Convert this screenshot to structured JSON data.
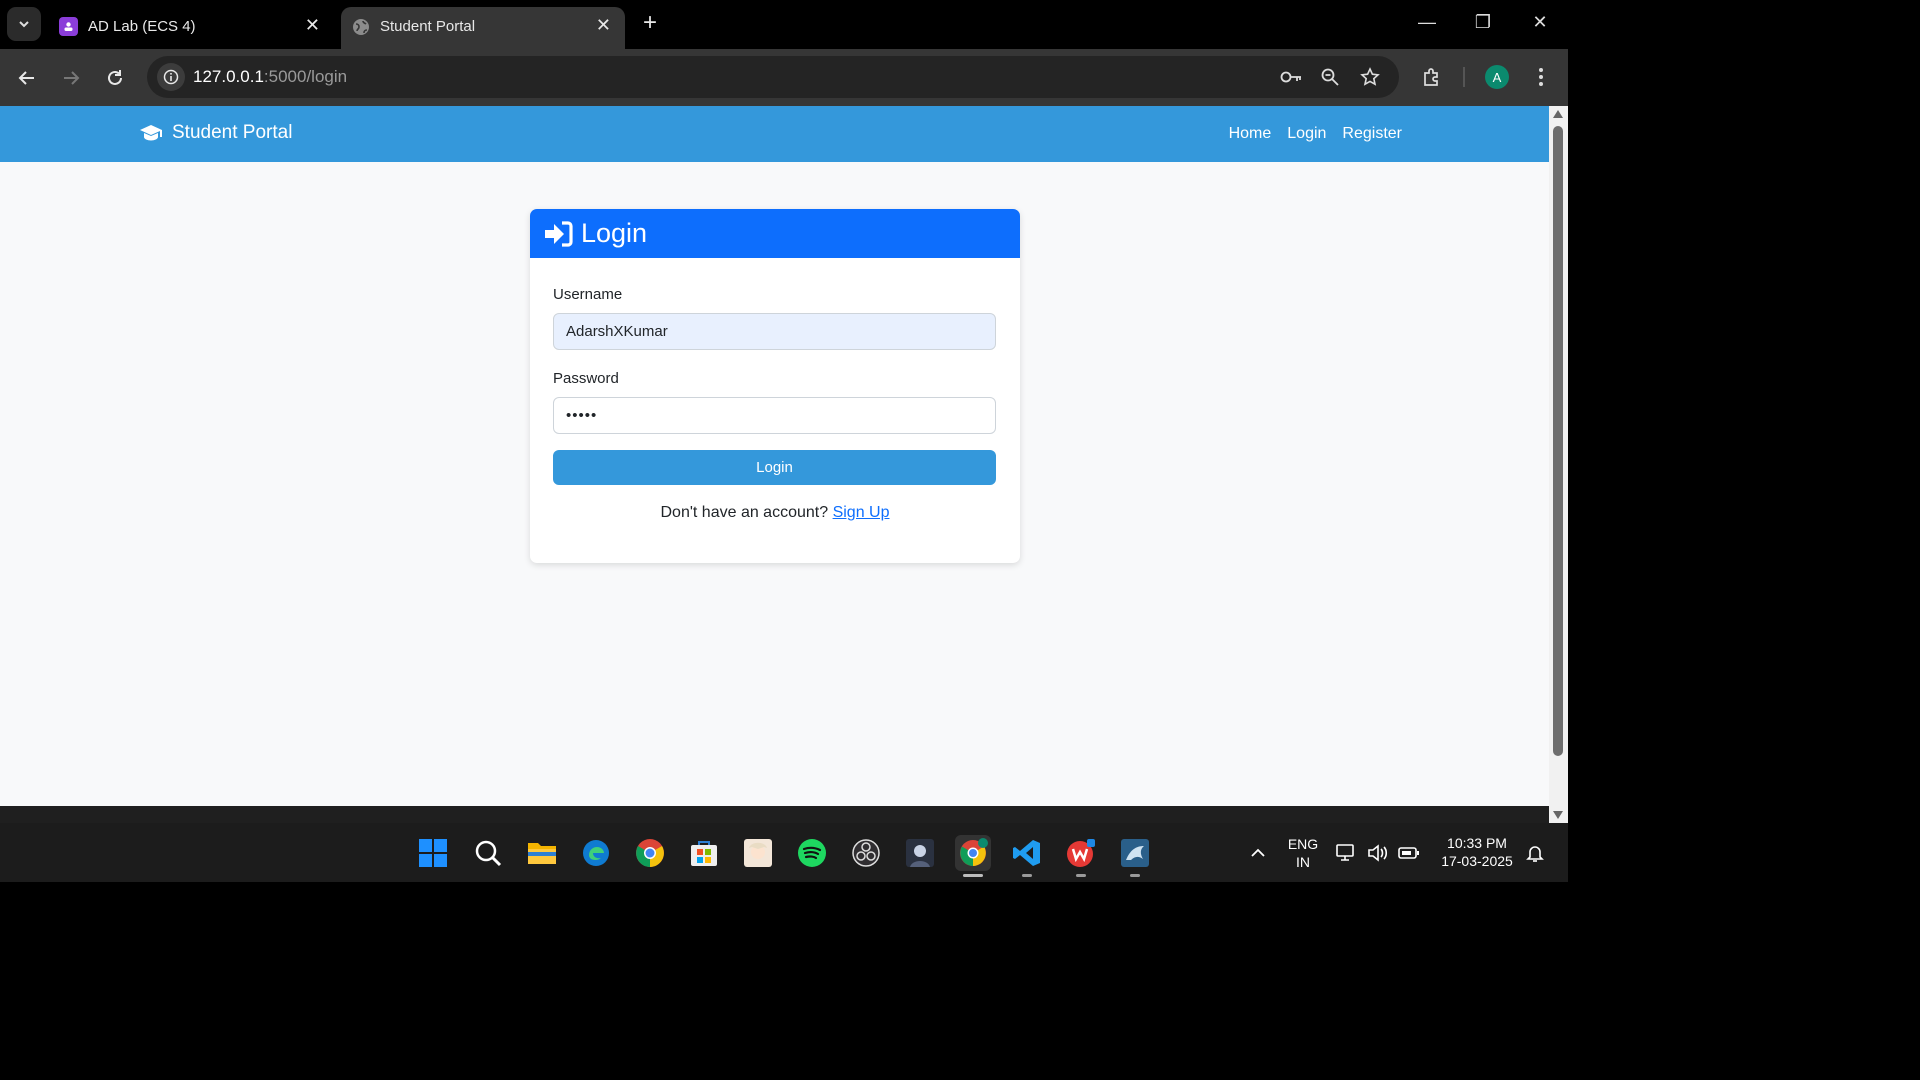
{
  "browser": {
    "tabs": [
      {
        "title": "AD Lab (ECS 4)",
        "active": false
      },
      {
        "title": "Student Portal",
        "active": true
      }
    ],
    "url_host": "127.0.0.1",
    "url_rest": ":5000/login",
    "profile_initial": "A"
  },
  "site": {
    "brand": "Student Portal",
    "nav": [
      "Home",
      "Login",
      "Register"
    ]
  },
  "login": {
    "header": "Login",
    "username_label": "Username",
    "username_value": "AdarshXKumar",
    "password_label": "Password",
    "password_value": "•••••",
    "submit_label": "Login",
    "signup_prompt": "Don't have an account?",
    "signup_link": "Sign Up"
  },
  "taskbar": {
    "lang_line1": "ENG",
    "lang_line2": "IN",
    "time": "10:33 PM",
    "date": "17-03-2025"
  },
  "colors": {
    "navbar": "#3498db",
    "card_header": "#0d6efd",
    "button": "#3498db",
    "link": "#0d6efd",
    "page_bg": "#f8f9fa"
  }
}
